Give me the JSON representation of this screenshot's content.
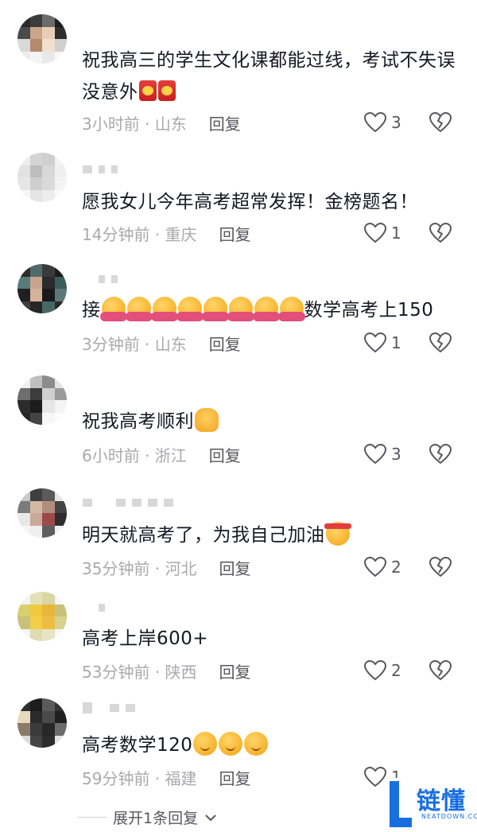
{
  "comments": [
    {
      "text": "祝我高三的学生文化课都能过线，考试不失误没意外",
      "emojis": [
        "red-envelope",
        "red-envelope"
      ],
      "meta": "3小时前 · 山东",
      "reply": "回复",
      "likes": "3"
    },
    {
      "text": "愿我女儿今年高考超常发挥！金榜题名！",
      "meta": "14分钟前 · 重庆",
      "reply": "回复",
      "likes": "1"
    },
    {
      "text_prefix": "接",
      "emojis": [
        "hug",
        "hug",
        "hug",
        "hug",
        "hug",
        "hug",
        "hug",
        "hug"
      ],
      "text": "数学高考上150",
      "meta": "3分钟前 · 山东",
      "reply": "回复",
      "likes": "1"
    },
    {
      "text": "祝我高考顺利",
      "emojis": [
        "pray"
      ],
      "meta": "6小时前 · 浙江",
      "reply": "回复",
      "likes": "3"
    },
    {
      "text": "明天就高考了，为我自己加油",
      "emojis": [
        "fighting"
      ],
      "meta": "35分钟前 · 河北",
      "reply": "回复",
      "likes": "2"
    },
    {
      "text": "高考上岸600+",
      "meta": "53分钟前 · 陕西",
      "reply": "回复",
      "likes": "2"
    },
    {
      "text": "高考数学120",
      "emojis": [
        "relieved",
        "relieved",
        "relieved"
      ],
      "meta": "59分钟前 · 福建",
      "reply": "回复",
      "likes": "1"
    }
  ],
  "expand_replies": "展开1条回复",
  "watermark": {
    "text": "链懂",
    "sub": "NEATDOWN.COM"
  },
  "colors": {
    "text": "#161823",
    "meta": "#a9a9ae",
    "action": "#57575f",
    "watermark": "#1a6fe0"
  }
}
